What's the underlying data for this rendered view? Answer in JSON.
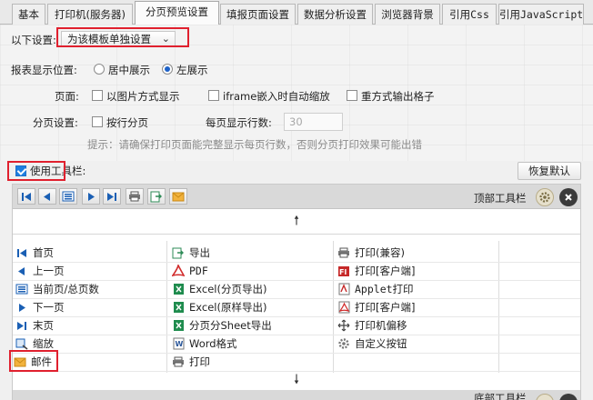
{
  "tabs": [
    {
      "label": "基本"
    },
    {
      "label": "打印机(服务器)"
    },
    {
      "label": "分页预览设置"
    },
    {
      "label": "填报页面设置"
    },
    {
      "label": "数据分析设置"
    },
    {
      "label": "浏览器背景"
    },
    {
      "label": "引用Css"
    },
    {
      "label": "引用JavaScript"
    }
  ],
  "settings": {
    "scope_label": "以下设置:",
    "scope_value": "为该模板单独设置"
  },
  "report_position": {
    "label": "报表显示位置:",
    "options": [
      "居中展示",
      "左展示"
    ],
    "selected": "左展示"
  },
  "page": {
    "label": "页面:",
    "options": [
      "以图片方式显示",
      "iframe嵌入时自动缩放",
      "重方式输出格子"
    ]
  },
  "paging": {
    "label": "分页设置:",
    "by_row": "按行分页",
    "rows_label": "每页显示行数:",
    "rows_value": "30"
  },
  "hint": "提示：请确保打印页面能完整显示每页行数，否则分页打印效果可能出错",
  "toolbar_settings": {
    "use_toolbar_label": "使用工具栏:",
    "use_toolbar_checked": true,
    "restore_button": "恢复默认"
  },
  "top_toolbar": {
    "label": "顶部工具栏"
  },
  "bottom_toolbar": {
    "label": "底部工具栏"
  },
  "buttons": {
    "col1": [
      "首页",
      "上一页",
      "当前页/总页数",
      "下一页",
      "末页",
      "缩放",
      "邮件"
    ],
    "col2": [
      "导出",
      "PDF",
      "Excel(分页导出)",
      "Excel(原样导出)",
      "分页分Sheet导出",
      "Word格式",
      "打印"
    ],
    "col3": [
      "打印(兼容)",
      "打印[客户端]",
      "Applet打印",
      "打印[客户端]",
      "打印机偏移",
      "自定义按钮"
    ]
  },
  "colors": {
    "accent_blue": "#1e62c8",
    "highlight_red": "#e0202e"
  }
}
